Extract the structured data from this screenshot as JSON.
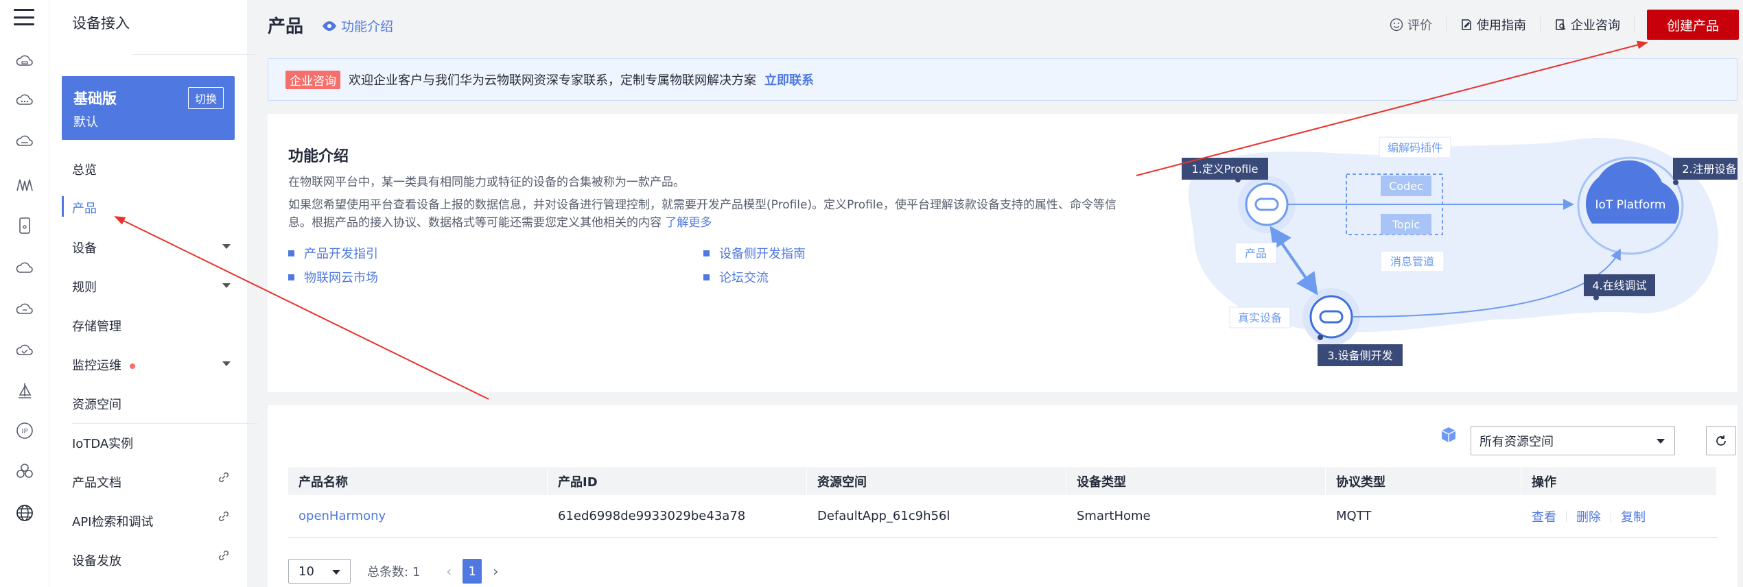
{
  "sidebar": {
    "title": "设备接入",
    "edition": {
      "name": "基础版",
      "sub": "默认",
      "switch_label": "切换"
    },
    "items": [
      {
        "label": "总览"
      },
      {
        "label": "产品"
      },
      {
        "label": "设备"
      },
      {
        "label": "规则"
      },
      {
        "label": "存储管理"
      },
      {
        "label": "监控运维"
      },
      {
        "label": "资源空间"
      },
      {
        "label": "IoTDA实例"
      },
      {
        "label": "产品文档"
      },
      {
        "label": "API检索和调试"
      },
      {
        "label": "设备发放"
      }
    ]
  },
  "header": {
    "title": "产品",
    "func_intro": "功能介绍",
    "toolbar": {
      "rate": "评价",
      "guide": "使用指南",
      "consult": "企业咨询",
      "create": "创建产品"
    }
  },
  "banner": {
    "badge": "企业咨询",
    "text": "欢迎企业客户与我们华为云物联网资深专家联系，定制专属物联网解决方案",
    "link": "立即联系"
  },
  "intro": {
    "title": "功能介绍",
    "p1": "在物联网平台中，某一类具有相同能力或特征的设备的合集被称为一款产品。",
    "p2": "如果您希望使用平台查看设备上报的数据信息，并对设备进行管理控制，就需要开发产品模型(Profile)。定义Profile，使平台理解该款设备支持的属性、命令等信息。根据产品的接入协议、数据格式等可能还需要您定义其他相关的内容",
    "more": "了解更多",
    "links": [
      "产品开发指引",
      "设备侧开发指南",
      "物联网云市场",
      "论坛交流"
    ]
  },
  "diagram": {
    "step1": "1.定义Profile",
    "step2": "2.注册设备",
    "step3": "3.设备侧开发",
    "step4": "4.在线调试",
    "codec_plugin": "编解码插件",
    "codec": "Codec",
    "topic": "Topic",
    "msg_channel": "消息管道",
    "product": "产品",
    "real_device": "真实设备",
    "platform": "IoT Platform"
  },
  "products": {
    "resource_select": "所有资源空间",
    "columns": [
      "产品名称",
      "产品ID",
      "资源空间",
      "设备类型",
      "协议类型",
      "操作"
    ],
    "rows": [
      {
        "name": "openHarmony",
        "id": "61ed6998de9933029be43a78",
        "space": "DefaultApp_61c9h56l",
        "type": "SmartHome",
        "protocol": "MQTT",
        "ops": [
          "查看",
          "删除",
          "复制"
        ]
      }
    ],
    "pager": {
      "size": "10",
      "total_label": "总条数:",
      "total": "1",
      "page": "1"
    }
  },
  "colors": {
    "accent": "#4f79e0",
    "primary_red": "#c7000b",
    "annotation": "#e8332c"
  }
}
